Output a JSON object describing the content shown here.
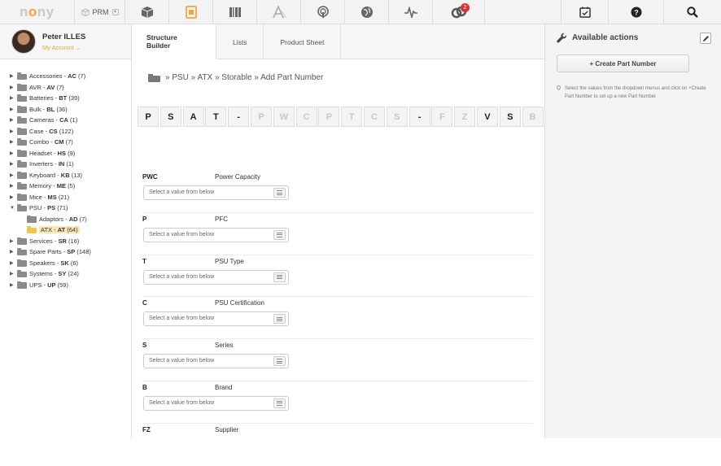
{
  "topbar": {
    "logo_prefix": "n",
    "logo_mid": "o",
    "logo_suffix": "y",
    "prm_label": "PRM",
    "notification_count": "2",
    "accent_color": "#f4a43a"
  },
  "profile": {
    "name": "Peter ILLES",
    "account_link": "My Account"
  },
  "tree": [
    {
      "label": "Accessories - ",
      "code": "AC",
      "count": " (7)"
    },
    {
      "label": "AVR - ",
      "code": "AV",
      "count": " (7)"
    },
    {
      "label": "Batteries - ",
      "code": "BT",
      "count": " (39)"
    },
    {
      "label": "Bulk - ",
      "code": "BL",
      "count": " (36)"
    },
    {
      "label": "Cameras - ",
      "code": "CA",
      "count": " (1)"
    },
    {
      "label": "Case - ",
      "code": "CS",
      "count": " (122)"
    },
    {
      "label": "Combo - ",
      "code": "CM",
      "count": " (7)"
    },
    {
      "label": "Headset - ",
      "code": "HS",
      "count": " (9)"
    },
    {
      "label": "Inverters - ",
      "code": "IN",
      "count": " (1)"
    },
    {
      "label": "Keyboard - ",
      "code": "KB",
      "count": " (13)"
    },
    {
      "label": "Memory - ",
      "code": "ME",
      "count": " (5)"
    },
    {
      "label": "Mice - ",
      "code": "MS",
      "count": " (21)"
    },
    {
      "label": "PSU - ",
      "code": "PS",
      "count": " (71)"
    },
    {
      "label": "Adaptors - ",
      "code": "AD",
      "count": " (7)"
    },
    {
      "label": "ATX - ",
      "code": "AT",
      "count": " (64)"
    },
    {
      "label": "Services - ",
      "code": "SR",
      "count": " (16)"
    },
    {
      "label": "Spare Parts - ",
      "code": "SP",
      "count": " (148)"
    },
    {
      "label": "Speakers - ",
      "code": "SK",
      "count": " (6)"
    },
    {
      "label": "Systems - ",
      "code": "SY",
      "count": " (24)"
    },
    {
      "label": "UPS - ",
      "code": "UP",
      "count": " (59)"
    }
  ],
  "tabs": {
    "structure_builder": "Structure Builder",
    "lists": "Lists",
    "product_sheet": "Product Sheet"
  },
  "breadcrumb": {
    "text": "» PSU  » ATX  » Storable » Add Part Number"
  },
  "code_chars": [
    {
      "c": "P",
      "dim": false
    },
    {
      "c": "S",
      "dim": false
    },
    {
      "c": "A",
      "dim": false
    },
    {
      "c": "T",
      "dim": false
    },
    {
      "c": "-",
      "dim": false
    },
    {
      "c": "P",
      "dim": true
    },
    {
      "c": "W",
      "dim": true
    },
    {
      "c": "C",
      "dim": true
    },
    {
      "c": "P",
      "dim": true
    },
    {
      "c": "T",
      "dim": true
    },
    {
      "c": "C",
      "dim": true
    },
    {
      "c": "S",
      "dim": true
    },
    {
      "c": "-",
      "dim": false
    },
    {
      "c": "F",
      "dim": true
    },
    {
      "c": "Z",
      "dim": true
    },
    {
      "c": "V",
      "dim": false
    },
    {
      "c": "S",
      "dim": false
    },
    {
      "c": "B",
      "dim": true
    }
  ],
  "fields": [
    {
      "code": "PWC",
      "name": "Power Capacity",
      "placeholder": "Select a value from below"
    },
    {
      "code": "P",
      "name": "PFC",
      "placeholder": "Select a value from below"
    },
    {
      "code": "T",
      "name": "PSU Type",
      "placeholder": "Select a value from below"
    },
    {
      "code": "C",
      "name": "PSU Certification",
      "placeholder": "Select a value from below"
    },
    {
      "code": "S",
      "name": "Series",
      "placeholder": "Select a value from below"
    },
    {
      "code": "B",
      "name": "Brand",
      "placeholder": "Select a value from below"
    },
    {
      "code": "FZ",
      "name": "Supplier",
      "placeholder": ""
    }
  ],
  "actions": {
    "title": "Available actions",
    "create_button": "+ Create Part Number",
    "hint": "Select the values from the dropdown menus and click on +Create Part Number to set up a new Part Number"
  }
}
